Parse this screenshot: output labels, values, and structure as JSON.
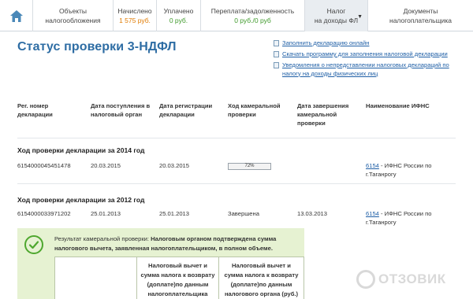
{
  "nav": {
    "home_icon": "house-icon",
    "tabs": [
      {
        "line1": "Объекты",
        "line2": "налогообложения"
      },
      {
        "line1": "Начислено",
        "value": "1 575 руб."
      },
      {
        "line1": "Уплачено",
        "value": "0 руб."
      },
      {
        "line1": "Переплата/задолженность",
        "value": "0 руб./0 руб"
      },
      {
        "line1": "Налог",
        "line2": "на доходы ФЛ"
      },
      {
        "line1": "Документы",
        "line2": "налогоплательщика"
      }
    ]
  },
  "page_title": "Статус проверки 3-НДФЛ",
  "links": [
    "Заполнить декларацию онлайн",
    "Скачать программу для заполнения налоговой декларации",
    "Уведомления о непредставлении налоговых деклараций по налогу на доходы физических лиц"
  ],
  "table": {
    "headers": [
      "Рег. номер декларации",
      "Дата поступления в налоговый орган",
      "Дата регистрации декларации",
      "Ход камеральной проверки",
      "Дата завершения камеральной проверки",
      "Наименование ИФНС"
    ],
    "groups": [
      {
        "title": "Ход проверки декларации за 2014 год",
        "reg_number": "6154000045451478",
        "received": "20.03.2015",
        "registered": "20.03.2015",
        "progress_label": "72%",
        "progress_value": 0.72,
        "completed": "",
        "ifns_code": "6154",
        "ifns_name": " - ИФНС России по г.Таганрогу"
      },
      {
        "title": "Ход проверки декларации за 2012 год",
        "reg_number": "6154000033971202",
        "received": "25.01.2013",
        "registered": "25.01.2013",
        "status": "Завершена",
        "completed": "13.03.2013",
        "ifns_code": "6154",
        "ifns_name": " - ИФНС России по г.Таганрогу"
      }
    ]
  },
  "result": {
    "label": "Результат камеральной проверки: ",
    "text": "Налоговым органом подтверждена сумма налогового вычета, заявленная налогоплательщиком, в полном объеме.",
    "columns": [
      "",
      "Налоговый вычет и сумма налога к возврату (доплате)по данным налогоплательщика (руб.)",
      "Налоговый вычет и сумма налога к возврату (доплате)по данным налогового органа (руб.)"
    ]
  },
  "watermark": "ОТЗОВИК",
  "colors": {
    "title_blue": "#2e6da4",
    "link_blue": "#1f5fa6",
    "accrued_orange": "#e07a00",
    "overpay_green": "#3f9a2b",
    "result_bg": "#e6f2d2",
    "check_green": "#4ea72e"
  }
}
